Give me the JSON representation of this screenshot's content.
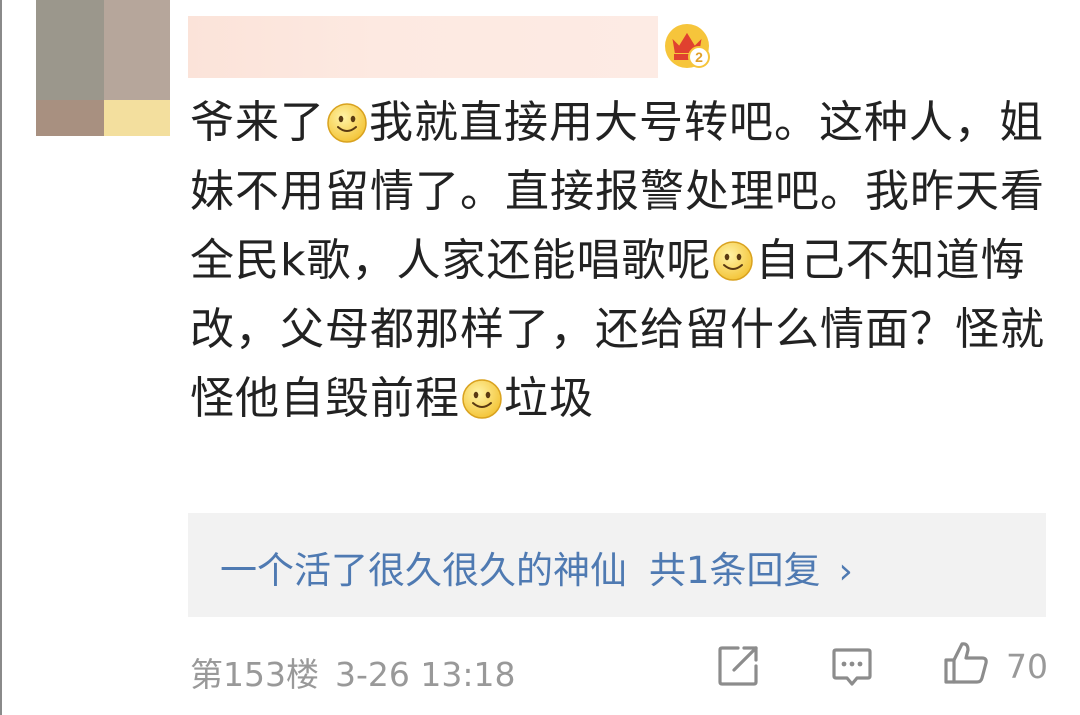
{
  "comment": {
    "segments": [
      {
        "type": "text",
        "value": "爷来了"
      },
      {
        "type": "emoji",
        "name": "smiley-icon"
      },
      {
        "type": "text",
        "value": "我就直接用大号转吧。这种人，姐妹不用留情了。直接报警处理吧。我昨天看全民k歌，人家还能唱歌呢"
      },
      {
        "type": "emoji",
        "name": "smiley-icon"
      },
      {
        "type": "text",
        "value": "自己不知道悔改，父母都那样了，还给留什么情面？怪就怪他自毁前程"
      },
      {
        "type": "emoji",
        "name": "smiley-icon"
      },
      {
        "type": "text",
        "value": "垃圾"
      }
    ]
  },
  "reply": {
    "user": "一个活了很久很久的神仙",
    "count_label": "共1条回复",
    "chevron": "›"
  },
  "meta": {
    "floor": "第153楼",
    "time": "3-26 13:18"
  },
  "actions": {
    "like_count": "70"
  },
  "icons": {
    "badge": "vip-crown-badge-icon",
    "share": "share-icon",
    "comment": "comment-icon",
    "like": "thumbs-up-icon",
    "emoji": "smiley-icon"
  },
  "colors": {
    "link": "#4f7ab2",
    "meta": "#999999",
    "text": "#222222",
    "reply_bg": "#f2f2f2"
  }
}
